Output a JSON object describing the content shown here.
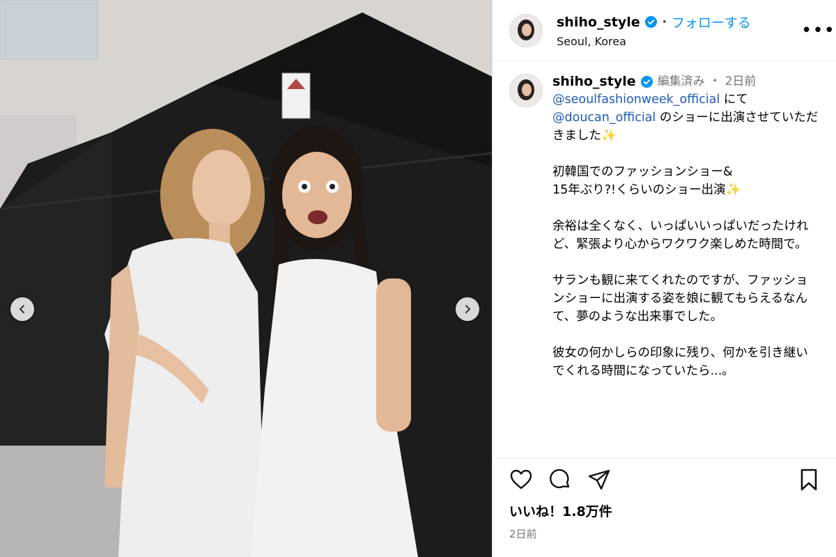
{
  "post": {
    "username": "shiho_style",
    "follow_label": "フォローする",
    "dot": "•",
    "location": "Seoul, Korea",
    "more_label": "•••"
  },
  "caption": {
    "username": "shiho_style",
    "edited": "編集済み",
    "dot": "・",
    "age": "2日前",
    "mention1": "@seoulfashionweek_official",
    "text1": " にて",
    "mention2": "@doucan_official",
    "text2": " のショーに出演させていただきました",
    "sparkle": "✨",
    "para2_line1": "初韓国でのファッションショー&",
    "para2_line2": "15年ぶり?!くらいのショー出演",
    "para3": "余裕は全くなく、いっぱいいっぱいだったけれど、緊張より心からワクワク楽しめた時間で。",
    "para4": "サランも観に来てくれたのですが、ファッションショーに出演する姿を娘に観てもらえるなんて、夢のような出来事でした。",
    "para5": "彼女の何かしらの印象に残り、何かを引き継いでくれる時間になっていたら...。"
  },
  "footer": {
    "likes": "いいね！1.8万件",
    "time": "2日前"
  },
  "colors": {
    "link": "#0095f6",
    "mention": "#1e5bb8",
    "muted": "#737373",
    "verified": "#0095f6"
  },
  "icons": [
    "verified-badge-icon",
    "heart-icon",
    "comment-icon",
    "share-icon",
    "bookmark-icon",
    "chevron-left-icon",
    "chevron-right-icon",
    "more-icon"
  ]
}
